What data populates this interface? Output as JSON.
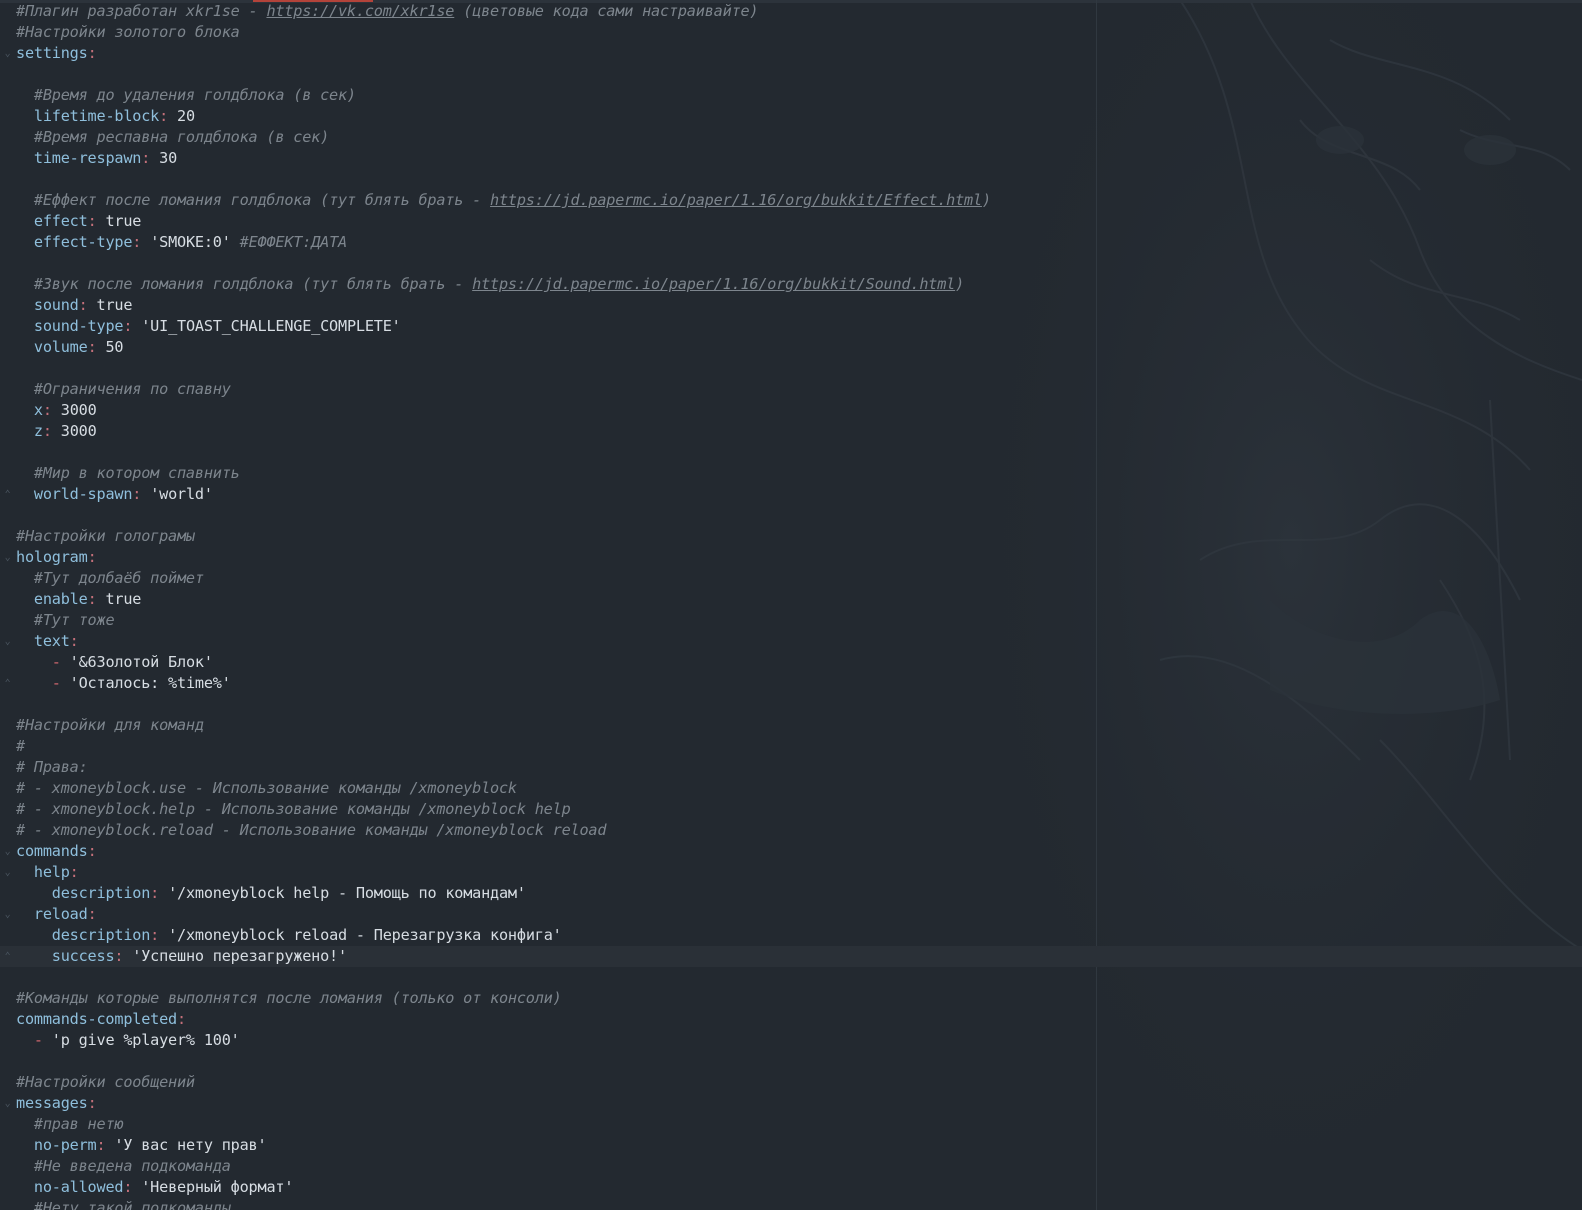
{
  "editor": {
    "name": "yaml-config-editor",
    "colors": {
      "background": "#232930",
      "comment": "#7d858d",
      "key": "#8fbfdc",
      "colon": "#c4707a",
      "value": "#d7dde3",
      "list_dash": "#d0666e"
    }
  },
  "lines": [
    {
      "comment": "#Плагин разработан xkr1se - ",
      "url": "https://vk.com/xkr1se",
      "comment_after": " (цветовые кода сами настраивайте)"
    },
    {
      "comment": "#Настройки золотого блока"
    },
    {
      "key": "settings",
      "fold": true
    },
    {},
    {
      "indent": 1,
      "comment": "#Время до удаления голдблока (в сек)"
    },
    {
      "indent": 1,
      "key": "lifetime-block",
      "value": "20"
    },
    {
      "indent": 1,
      "comment": "#Время респавна голдблока (в сек)"
    },
    {
      "indent": 1,
      "key": "time-respawn",
      "value": "30"
    },
    {},
    {
      "indent": 1,
      "comment": "#Еффект после ломания голдблока (тут блять брать - ",
      "url": "https://jd.papermc.io/paper/1.16/org/bukkit/Effect.html",
      "comment_after": ")"
    },
    {
      "indent": 1,
      "key": "effect",
      "value": "true"
    },
    {
      "indent": 1,
      "key": "effect-type",
      "value": "'SMOKE:0'",
      "trailing_comment": "#ЕФФЕКТ:ДАТА"
    },
    {},
    {
      "indent": 1,
      "comment": "#Звук после ломания голдблока (тут блять брать - ",
      "url": "https://jd.papermc.io/paper/1.16/org/bukkit/Sound.html",
      "comment_after": ")"
    },
    {
      "indent": 1,
      "key": "sound",
      "value": "true"
    },
    {
      "indent": 1,
      "key": "sound-type",
      "value": "'UI_TOAST_CHALLENGE_COMPLETE'"
    },
    {
      "indent": 1,
      "key": "volume",
      "value": "50"
    },
    {},
    {
      "indent": 1,
      "comment": "#Ограничения по спавну"
    },
    {
      "indent": 1,
      "key": "x",
      "value": "3000"
    },
    {
      "indent": 1,
      "key": "z",
      "value": "3000"
    },
    {},
    {
      "indent": 1,
      "comment": "#Мир в котором спавнить"
    },
    {
      "indent": 1,
      "key": "world-spawn",
      "value": "'world'",
      "fold_end": true
    },
    {},
    {
      "comment": "#Настройки голограмы"
    },
    {
      "key": "hologram",
      "fold": true
    },
    {
      "indent": 1,
      "comment": "#Тут долбаёб поймет"
    },
    {
      "indent": 1,
      "key": "enable",
      "value": "true"
    },
    {
      "indent": 1,
      "comment": "#Тут тоже"
    },
    {
      "indent": 1,
      "key": "text",
      "fold": true
    },
    {
      "indent": 2,
      "list_item": "'&6Золотой Блок'"
    },
    {
      "indent": 2,
      "list_item": "'Осталось: %time%'",
      "fold_end": true
    },
    {},
    {
      "comment": "#Настройки для команд"
    },
    {
      "comment": "#"
    },
    {
      "comment": "# Права:"
    },
    {
      "comment": "# - xmoneyblock.use - Использование команды /xmoneyblock"
    },
    {
      "comment": "# - xmoneyblock.help - Использование команды /xmoneyblock help"
    },
    {
      "comment": "# - xmoneyblock.reload - Использование команды /xmoneyblock reload"
    },
    {
      "key": "commands",
      "fold": true
    },
    {
      "indent": 1,
      "key": "help",
      "fold": true
    },
    {
      "indent": 2,
      "key": "description",
      "value": "'/xmoneyblock help - Помощь по командам'"
    },
    {
      "indent": 1,
      "key": "reload",
      "fold": true
    },
    {
      "indent": 2,
      "key": "description",
      "value": "'/xmoneyblock reload - Перезагрузка конфига'"
    },
    {
      "indent": 2,
      "key": "success",
      "value": "'Успешно перезагружено!'",
      "current": true,
      "fold_end": true
    },
    {},
    {
      "comment": "#Команды которые выполнятся после ломания (только от консоли)"
    },
    {
      "key": "commands-completed"
    },
    {
      "indent": 1,
      "list_item": "'p give %player% 100'"
    },
    {},
    {
      "comment": "#Настройки сообщений"
    },
    {
      "key": "messages",
      "fold": true
    },
    {
      "indent": 1,
      "comment": "#прав нетю"
    },
    {
      "indent": 1,
      "key": "no-perm",
      "value": "'У вас нету прав'"
    },
    {
      "indent": 1,
      "comment": "#Не введена подкоманда"
    },
    {
      "indent": 1,
      "key": "no-allowed",
      "value": "'Неверный формат'"
    },
    {
      "indent": 1,
      "comment": "#Нету такой подкоманды"
    }
  ]
}
